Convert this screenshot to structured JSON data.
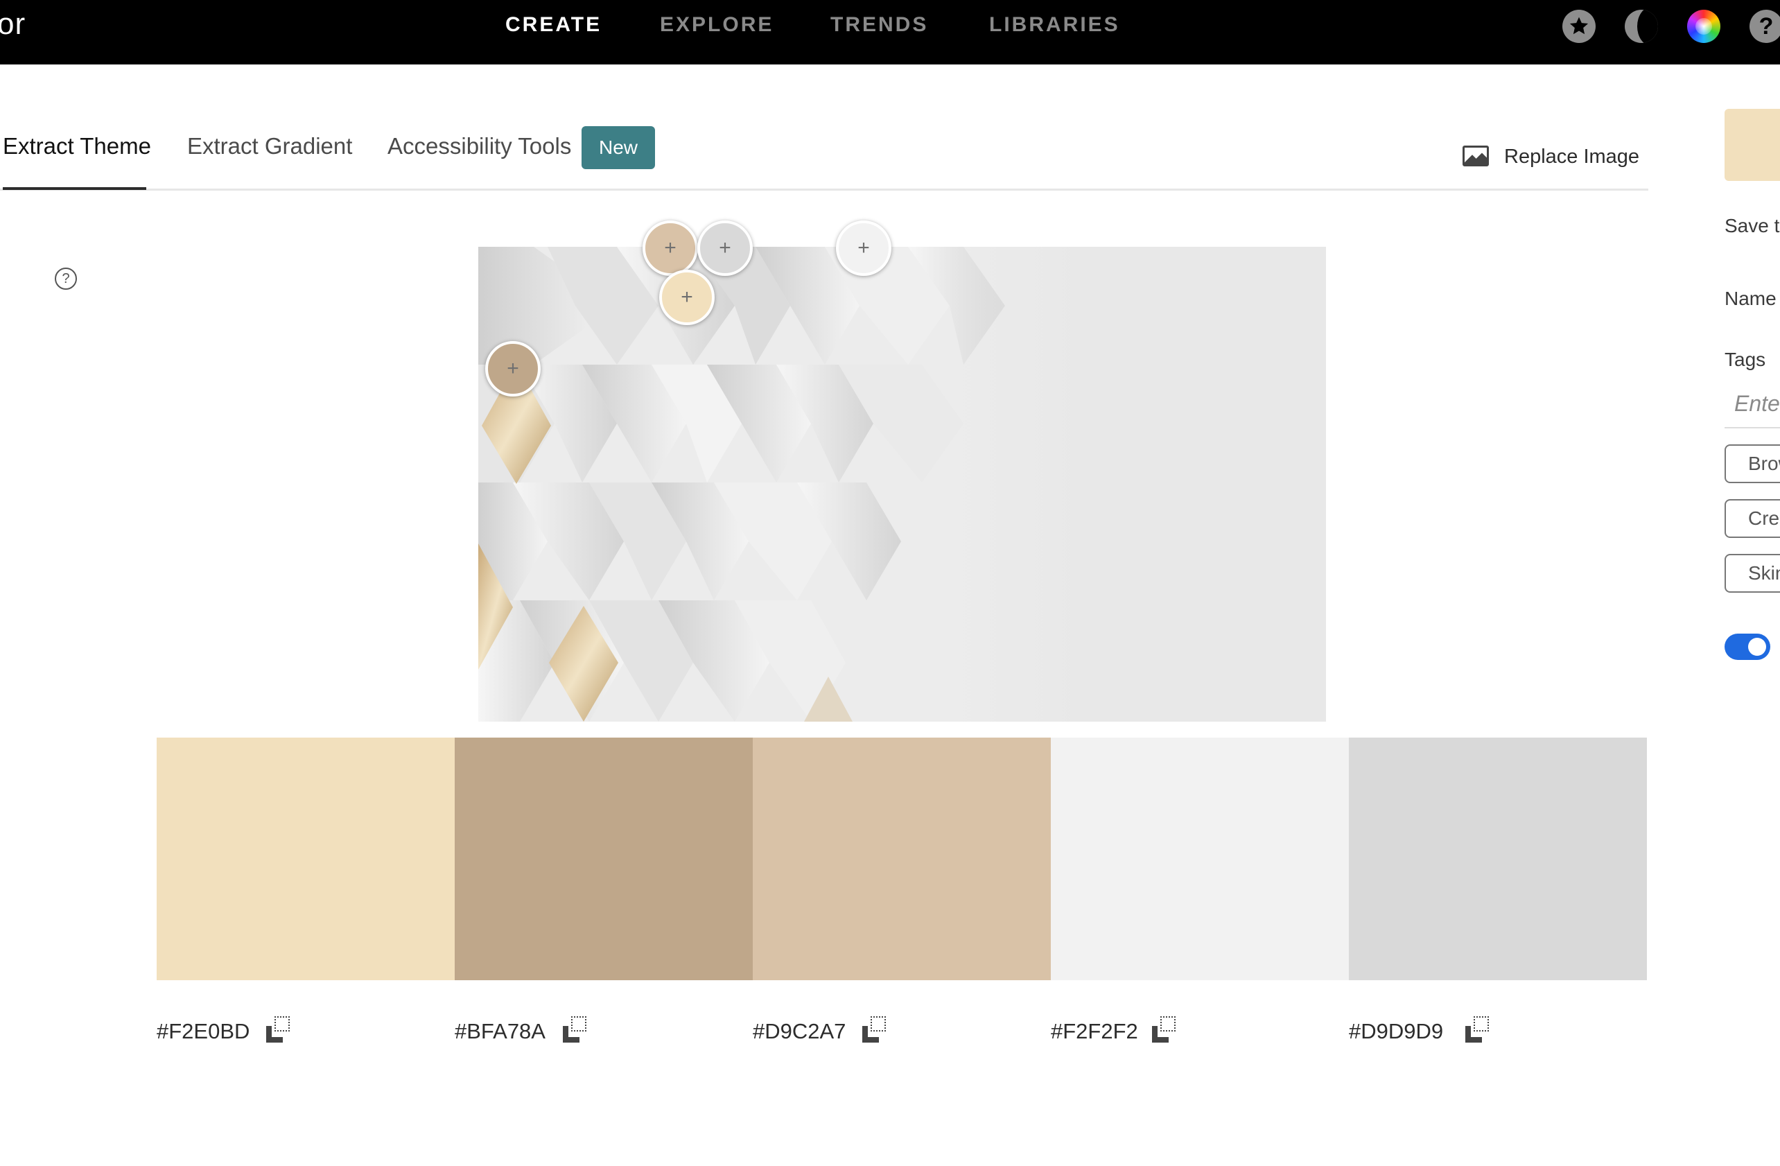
{
  "header": {
    "brand": "or",
    "nav": [
      "CREATE",
      "EXPLORE",
      "TRENDS",
      "LIBRARIES"
    ],
    "active_nav": "CREATE",
    "icons": [
      "star-icon",
      "moon-icon",
      "color-wheel-icon",
      "help-icon"
    ],
    "help_glyph": "?"
  },
  "tabs": {
    "items": [
      "Extract Theme",
      "Extract Gradient",
      "Accessibility Tools"
    ],
    "active": "Extract Theme",
    "badge": "New",
    "replace_image": "Replace Image"
  },
  "help_glyph": "?",
  "pickers": [
    {
      "color": "#D9C2A7",
      "glyph": "+"
    },
    {
      "color": "#D9D9D9",
      "glyph": "+"
    },
    {
      "color": "#F2F2F2",
      "glyph": "+"
    },
    {
      "color": "#F2E0BD",
      "glyph": "+"
    },
    {
      "color": "#BFA78A",
      "glyph": "+"
    }
  ],
  "swatches": [
    {
      "hex": "#F2E0BD"
    },
    {
      "hex": "#BFA78A"
    },
    {
      "hex": "#D9C2A7"
    },
    {
      "hex": "#F2F2F2"
    },
    {
      "hex": "#D9D9D9"
    }
  ],
  "panel": {
    "save_label": "Save to",
    "name_label": "Name",
    "tags_label": "Tags",
    "tags_placeholder": "Enter",
    "chips": [
      "Brown",
      "Cream",
      "Skin"
    ],
    "toggle_on": true
  },
  "colors": {
    "topbar": "#000000",
    "accent_badge": "#3D7F86",
    "toggle": "#1F6AE0"
  }
}
